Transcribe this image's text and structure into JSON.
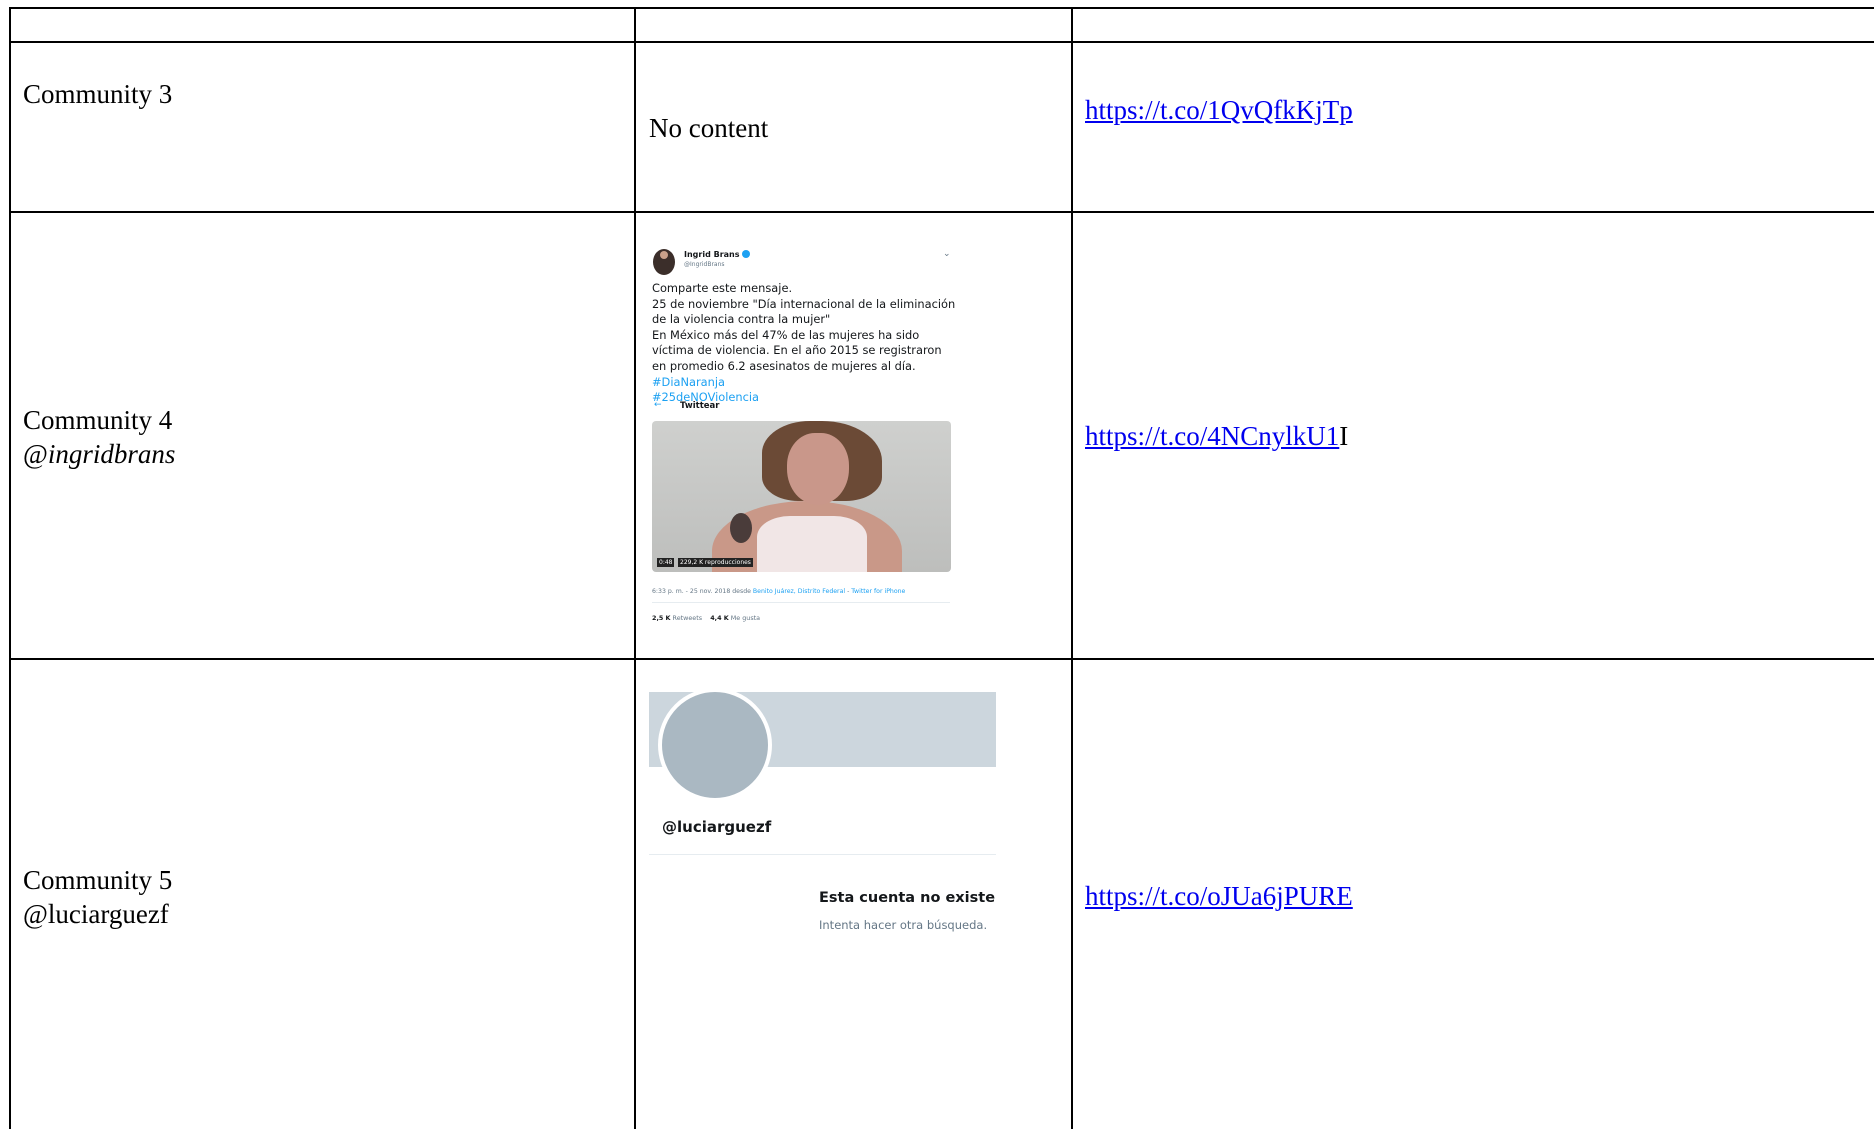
{
  "rows": [
    {
      "community": "Community 3",
      "user": "",
      "content_text": "No content",
      "link": "https://t.co/1QvQfkKjTp",
      "link_suffix": ""
    },
    {
      "community": "Community 4",
      "user_prefix": "@",
      "user_italic": "ingridbrans",
      "link": "https://t.co/4NCnylkU1",
      "link_suffix": "I",
      "tweet": {
        "name": "Ingrid Brans",
        "handle": "@IngridBrans",
        "body_plain": "Comparte este mensaje.\n25 de noviembre \"Día internacional de la eliminación de la violencia contra la mujer\"\nEn México más del 47% de las mujeres ha sido víctima de violencia. En el año 2015 se registraron en promedio 6.2 asesinatos de mujeres al día. ",
        "hashtag1": "#DiaNaranja",
        "hashtag2": "#25deNOViolencia",
        "back_arrow": "←",
        "twittear": "Twittear",
        "duration": "0:48",
        "views": "229,2 K reproducciones",
        "meta_time": "6:33 p. m. - 25 nov. 2018 desde ",
        "meta_place": "Benito Juárez, Distrito Federal",
        "meta_sep": " - ",
        "meta_client": "Twitter for iPhone",
        "retweets_count": "2,5 K",
        "retweets_label": "Retweets",
        "likes_count": "4,4 K",
        "likes_label": "Me gusta",
        "chevron": "⌄"
      }
    },
    {
      "community": "Community 5",
      "user": "@luciarguezf",
      "link": "https://t.co/oJUa6jPURE",
      "link_suffix": "",
      "profile": {
        "handle": "@luciarguezf",
        "headline": "Esta cuenta no existe",
        "sub": "Intenta hacer otra búsqueda."
      }
    }
  ]
}
